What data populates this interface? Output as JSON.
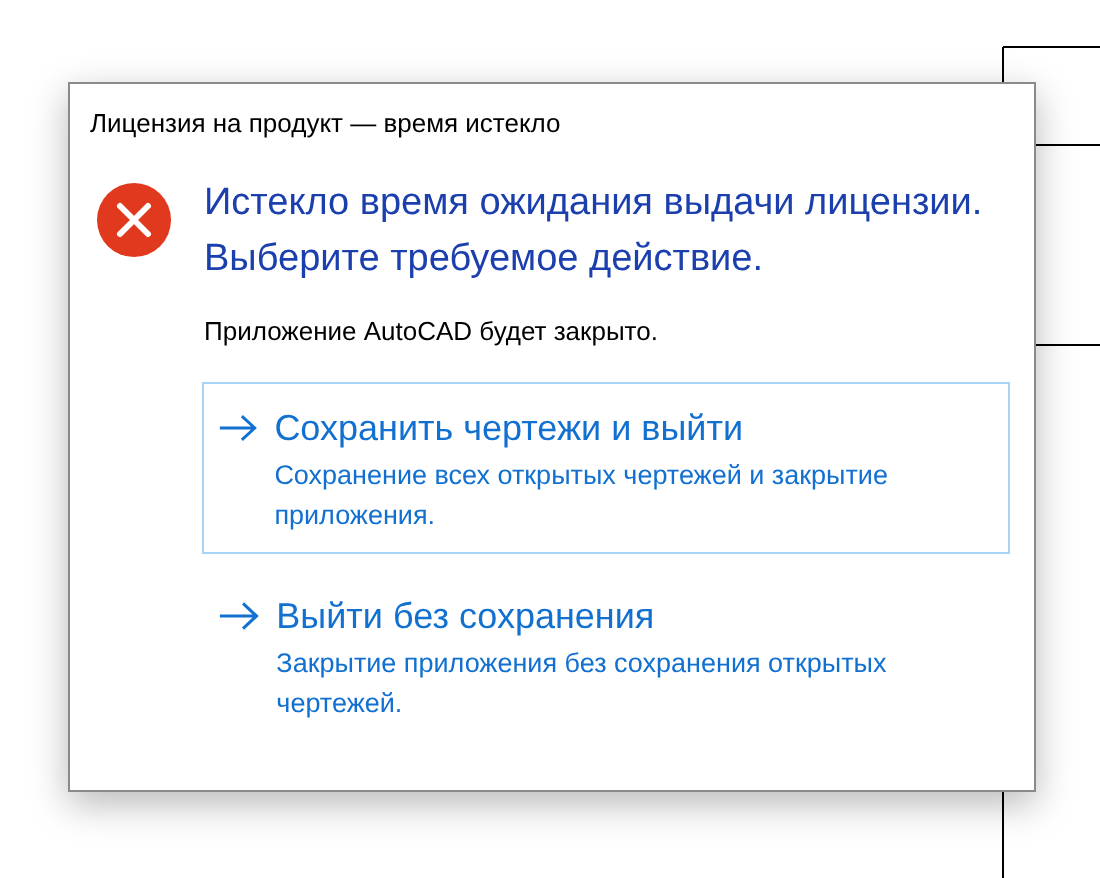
{
  "window": {
    "title": "Лицензия на продукт — время истекло"
  },
  "heading": "Истекло время ожидания выдачи лицензии. Выберите требуемое действие.",
  "message": "Приложение AutoCAD будет закрыто.",
  "commands": [
    {
      "title": "Сохранить чертежи и выйти",
      "description": "Сохранение всех открытых чертежей и закрытие приложения.",
      "selected": true
    },
    {
      "title": "Выйти без сохранения",
      "description": "Закрытие приложения без сохранения открытых чертежей.",
      "selected": false
    }
  ]
}
